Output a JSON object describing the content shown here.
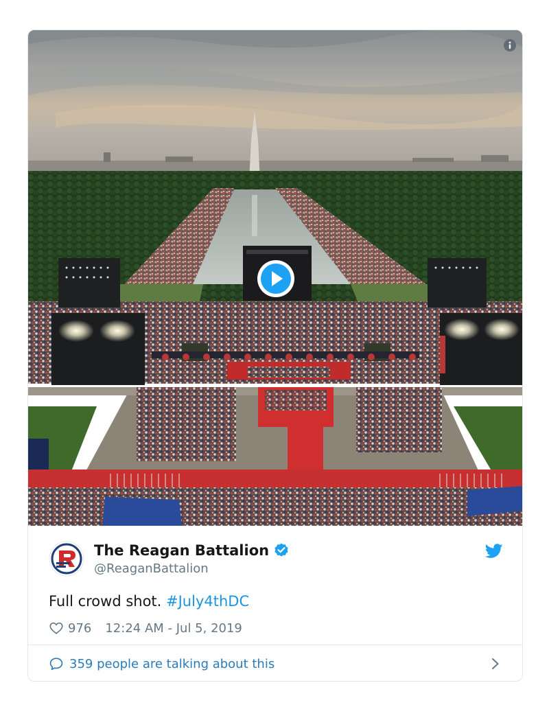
{
  "media": {
    "has_video": true
  },
  "tweet": {
    "display_name": "The Reagan Battalion",
    "handle": "@ReaganBattalion",
    "text": "Full crowd shot. ",
    "hashtag": "#July4thDC",
    "like_count": "976",
    "timestamp": "12:24 AM - Jul 5, 2019",
    "verified": true
  },
  "footer": {
    "talking_text": "359 people are talking about this"
  },
  "colors": {
    "link": "#1b95e0",
    "twitter_blue": "#1da1f2",
    "muted": "#657786"
  },
  "icons": {
    "info": "info-icon",
    "play": "play-icon",
    "verified": "verified-badge-icon",
    "twitter": "twitter-bird-icon",
    "like": "heart-icon",
    "reply": "speech-bubble-icon",
    "more": "chevron-right-icon"
  }
}
